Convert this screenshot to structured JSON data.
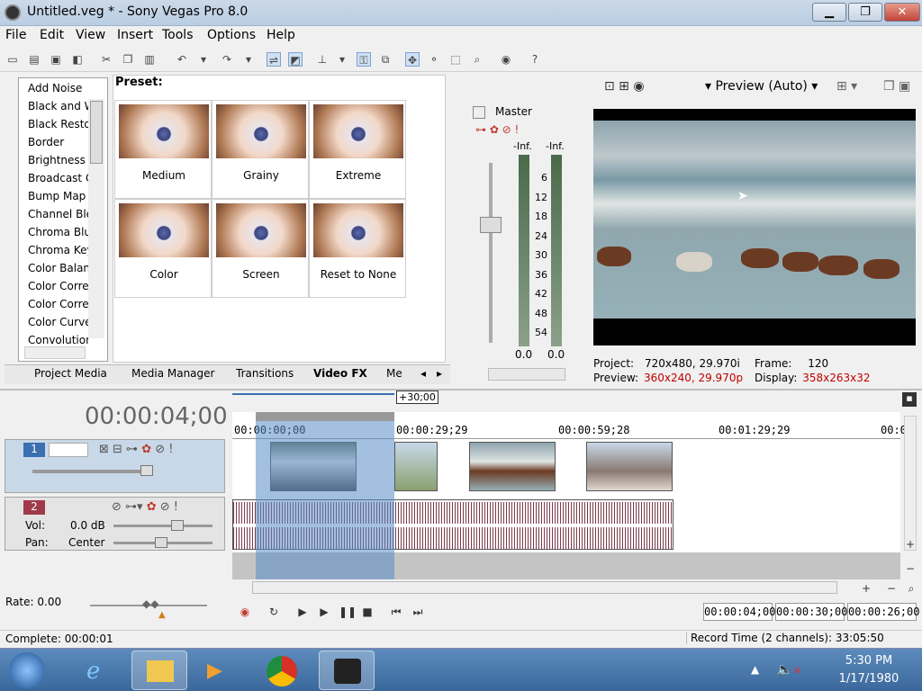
{
  "window": {
    "title": "Untitled.veg * - Sony Vegas Pro 8.0",
    "min": "▁",
    "max": "❐",
    "close": "✕"
  },
  "menu": [
    "File",
    "Edit",
    "View",
    "Insert",
    "Tools",
    "Options",
    "Help"
  ],
  "fx": {
    "items": [
      "Add Noise",
      "Black and W",
      "Black Resto",
      "Border",
      "Brightness a",
      "Broadcast C",
      "Bump Map",
      "Channel Ble",
      "Chroma Blu",
      "Chroma Key",
      "Color Balan",
      "Color Corre",
      "Color Corre",
      "Color Curve",
      "Convolution"
    ]
  },
  "presets": {
    "label": "Preset:",
    "items": [
      "Medium",
      "Grainy",
      "Extreme",
      "Color",
      "Screen",
      "Reset to None"
    ]
  },
  "tabs": [
    "Project Media",
    "Media Manager",
    "Transitions",
    "Video FX",
    "Me"
  ],
  "mixer": {
    "master": "Master",
    "inf_l": "-Inf.",
    "inf_r": "-Inf.",
    "scale": [
      "6",
      "12",
      "18",
      "24",
      "30",
      "36",
      "42",
      "48",
      "54"
    ],
    "val_l": "0.0",
    "val_r": "0.0"
  },
  "preview": {
    "mode": "Preview (Auto)",
    "project_label": "Project:",
    "project": "720x480, 29.970i",
    "frame_label": "Frame:",
    "frame": "120",
    "preview_label": "Preview:",
    "preview_val": "360x240, 29.970p",
    "display_label": "Display:",
    "display": "358x263x32"
  },
  "timeline": {
    "time": "00:00:04;00",
    "marker": "+30;00",
    "ruler": [
      "00:00:00;00",
      "00:00:29;29",
      "00:00:59;28",
      "00:01:29;29",
      "00:0"
    ],
    "track1_num": "1",
    "track2_num": "2",
    "vol_label": "Vol:",
    "vol": "0.0 dB",
    "pan_label": "Pan:",
    "pan": "Center"
  },
  "transport": {
    "rate_label": "Rate: 0.00",
    "tc1": "00:00:04;00",
    "tc2": "00:00:30;00",
    "tc3": "00:00:26;00"
  },
  "status": {
    "left": "Complete: 00:00:01",
    "right": "Record Time (2 channels): 33:05:50"
  },
  "taskbar": {
    "time": "5:30 PM",
    "date": "1/17/1980"
  },
  "colors": {
    "accent": "#2f66b3",
    "preview_red": "#c00000"
  }
}
